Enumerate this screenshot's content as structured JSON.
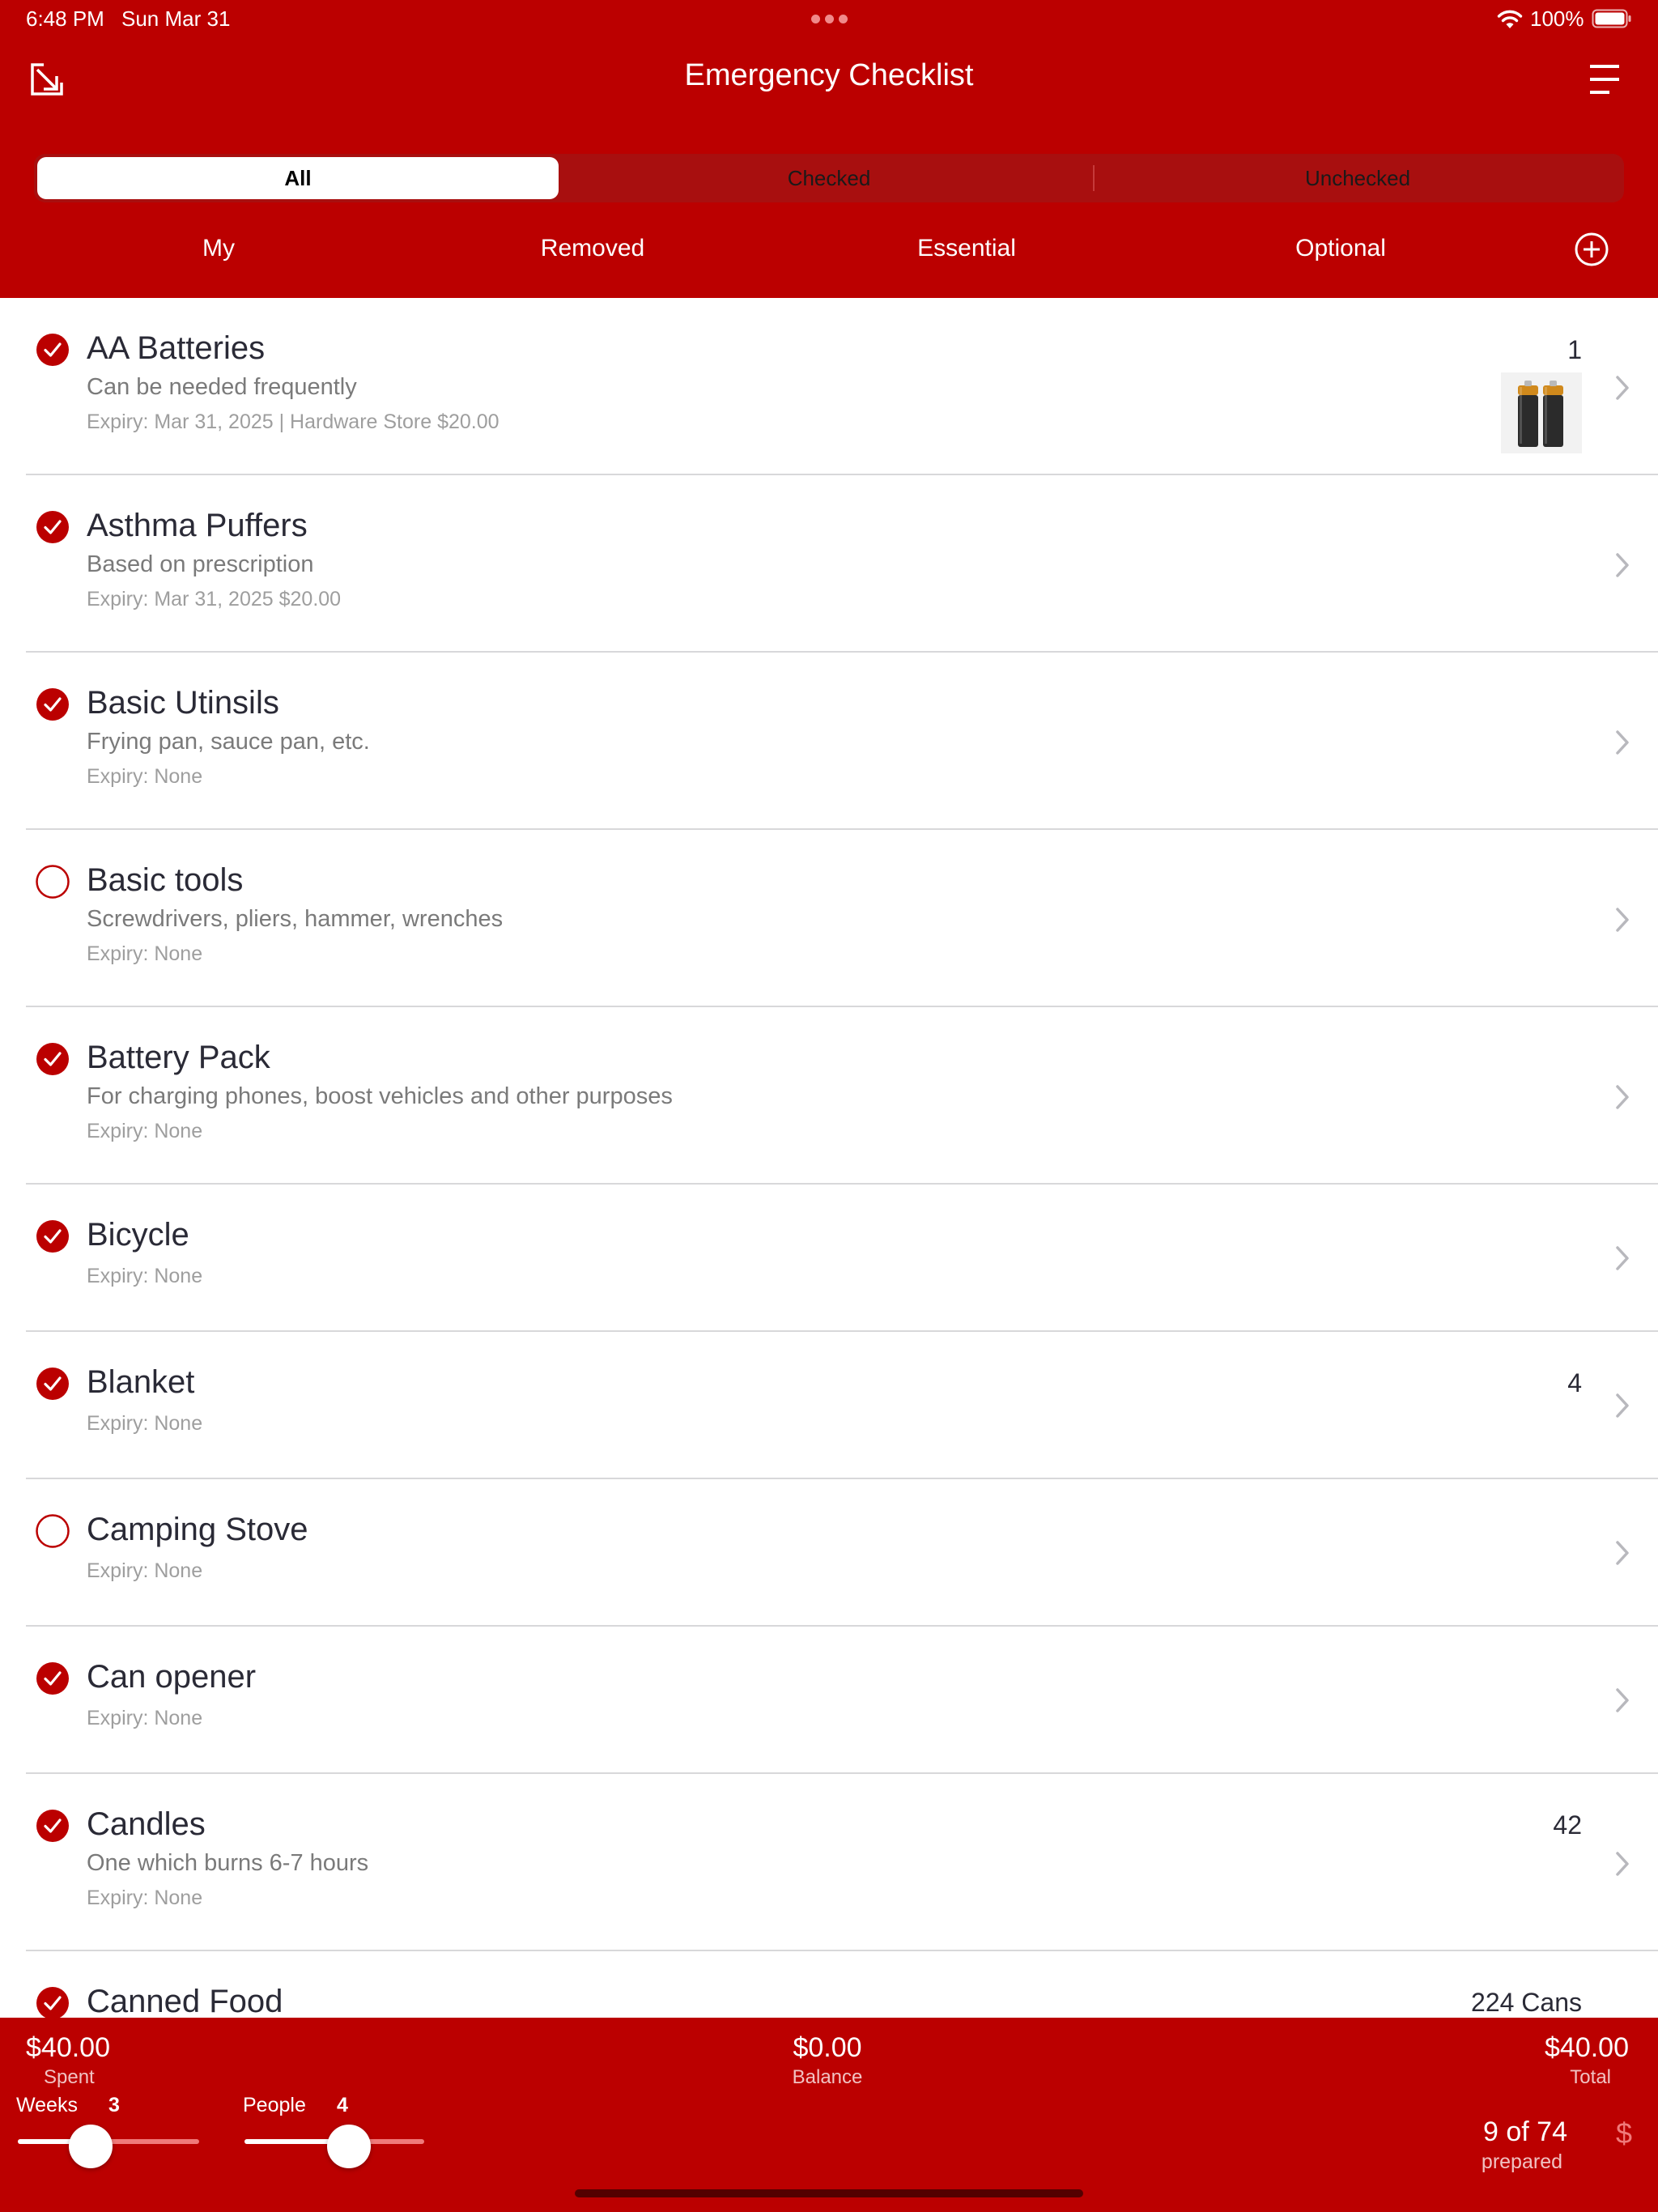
{
  "status_bar": {
    "time": "6:48 PM",
    "date": "Sun Mar 31",
    "battery": "100%"
  },
  "nav": {
    "title": "Emergency Checklist"
  },
  "segments": {
    "all": "All",
    "checked": "Checked",
    "unchecked": "Unchecked",
    "selected": "All"
  },
  "filters": {
    "my": "My",
    "removed": "Removed",
    "essential": "Essential",
    "optional": "Optional"
  },
  "items": [
    {
      "title": "AA Batteries",
      "description": "Can be needed frequently",
      "meta": "Expiry: Mar 31, 2025 | Hardware Store  $20.00",
      "quantity": "1",
      "checked": true,
      "has_image": true
    },
    {
      "title": "Asthma Puffers",
      "description": "Based on prescription",
      "meta": "Expiry: Mar 31, 2025  $20.00",
      "quantity": "",
      "checked": true
    },
    {
      "title": "Basic Utinsils",
      "description": "Frying pan, sauce pan, etc.",
      "meta": "Expiry: None",
      "quantity": "",
      "checked": true
    },
    {
      "title": "Basic tools",
      "description": "Screwdrivers, pliers, hammer, wrenches",
      "meta": "Expiry: None",
      "quantity": "",
      "checked": false
    },
    {
      "title": "Battery Pack",
      "description": "For charging phones, boost vehicles and other purposes",
      "meta": "Expiry: None",
      "quantity": "",
      "checked": true
    },
    {
      "title": "Bicycle",
      "description": "",
      "meta": "Expiry: None",
      "quantity": "",
      "checked": true
    },
    {
      "title": "Blanket",
      "description": "",
      "meta": "Expiry: None",
      "quantity": "4",
      "checked": true
    },
    {
      "title": "Camping Stove",
      "description": "",
      "meta": "Expiry: None",
      "quantity": "",
      "checked": false
    },
    {
      "title": "Can opener",
      "description": "",
      "meta": "Expiry: None",
      "quantity": "",
      "checked": true
    },
    {
      "title": "Candles",
      "description": "One which burns 6-7 hours",
      "meta": "Expiry: None",
      "quantity": "42",
      "checked": true
    },
    {
      "title": "Canned Food",
      "description": "",
      "meta": "",
      "quantity": "224 Cans",
      "checked": true
    }
  ],
  "footer": {
    "spent": {
      "amount": "$40.00",
      "label": "Spent"
    },
    "balance": {
      "amount": "$0.00",
      "label": "Balance"
    },
    "total": {
      "amount": "$40.00",
      "label": "Total"
    },
    "weeks": {
      "label": "Weeks",
      "value": "3",
      "fill_fraction": 0.4
    },
    "people": {
      "label": "People",
      "value": "4",
      "fill_fraction": 0.58
    },
    "prepared": {
      "count": "9 of 74",
      "label": "prepared"
    },
    "currency_symbol": "$"
  },
  "colors": {
    "primary": "#BB0000",
    "segment_bg": "#A80F0F",
    "separator": "#d8d8da"
  },
  "icons": {
    "nav_left": "collapse-arrow-icon",
    "nav_right": "menu-icon",
    "add": "plus-circle-icon",
    "checked": "check-circle-icon",
    "unchecked": "empty-circle-icon",
    "row_action": "chevron-right-icon"
  }
}
